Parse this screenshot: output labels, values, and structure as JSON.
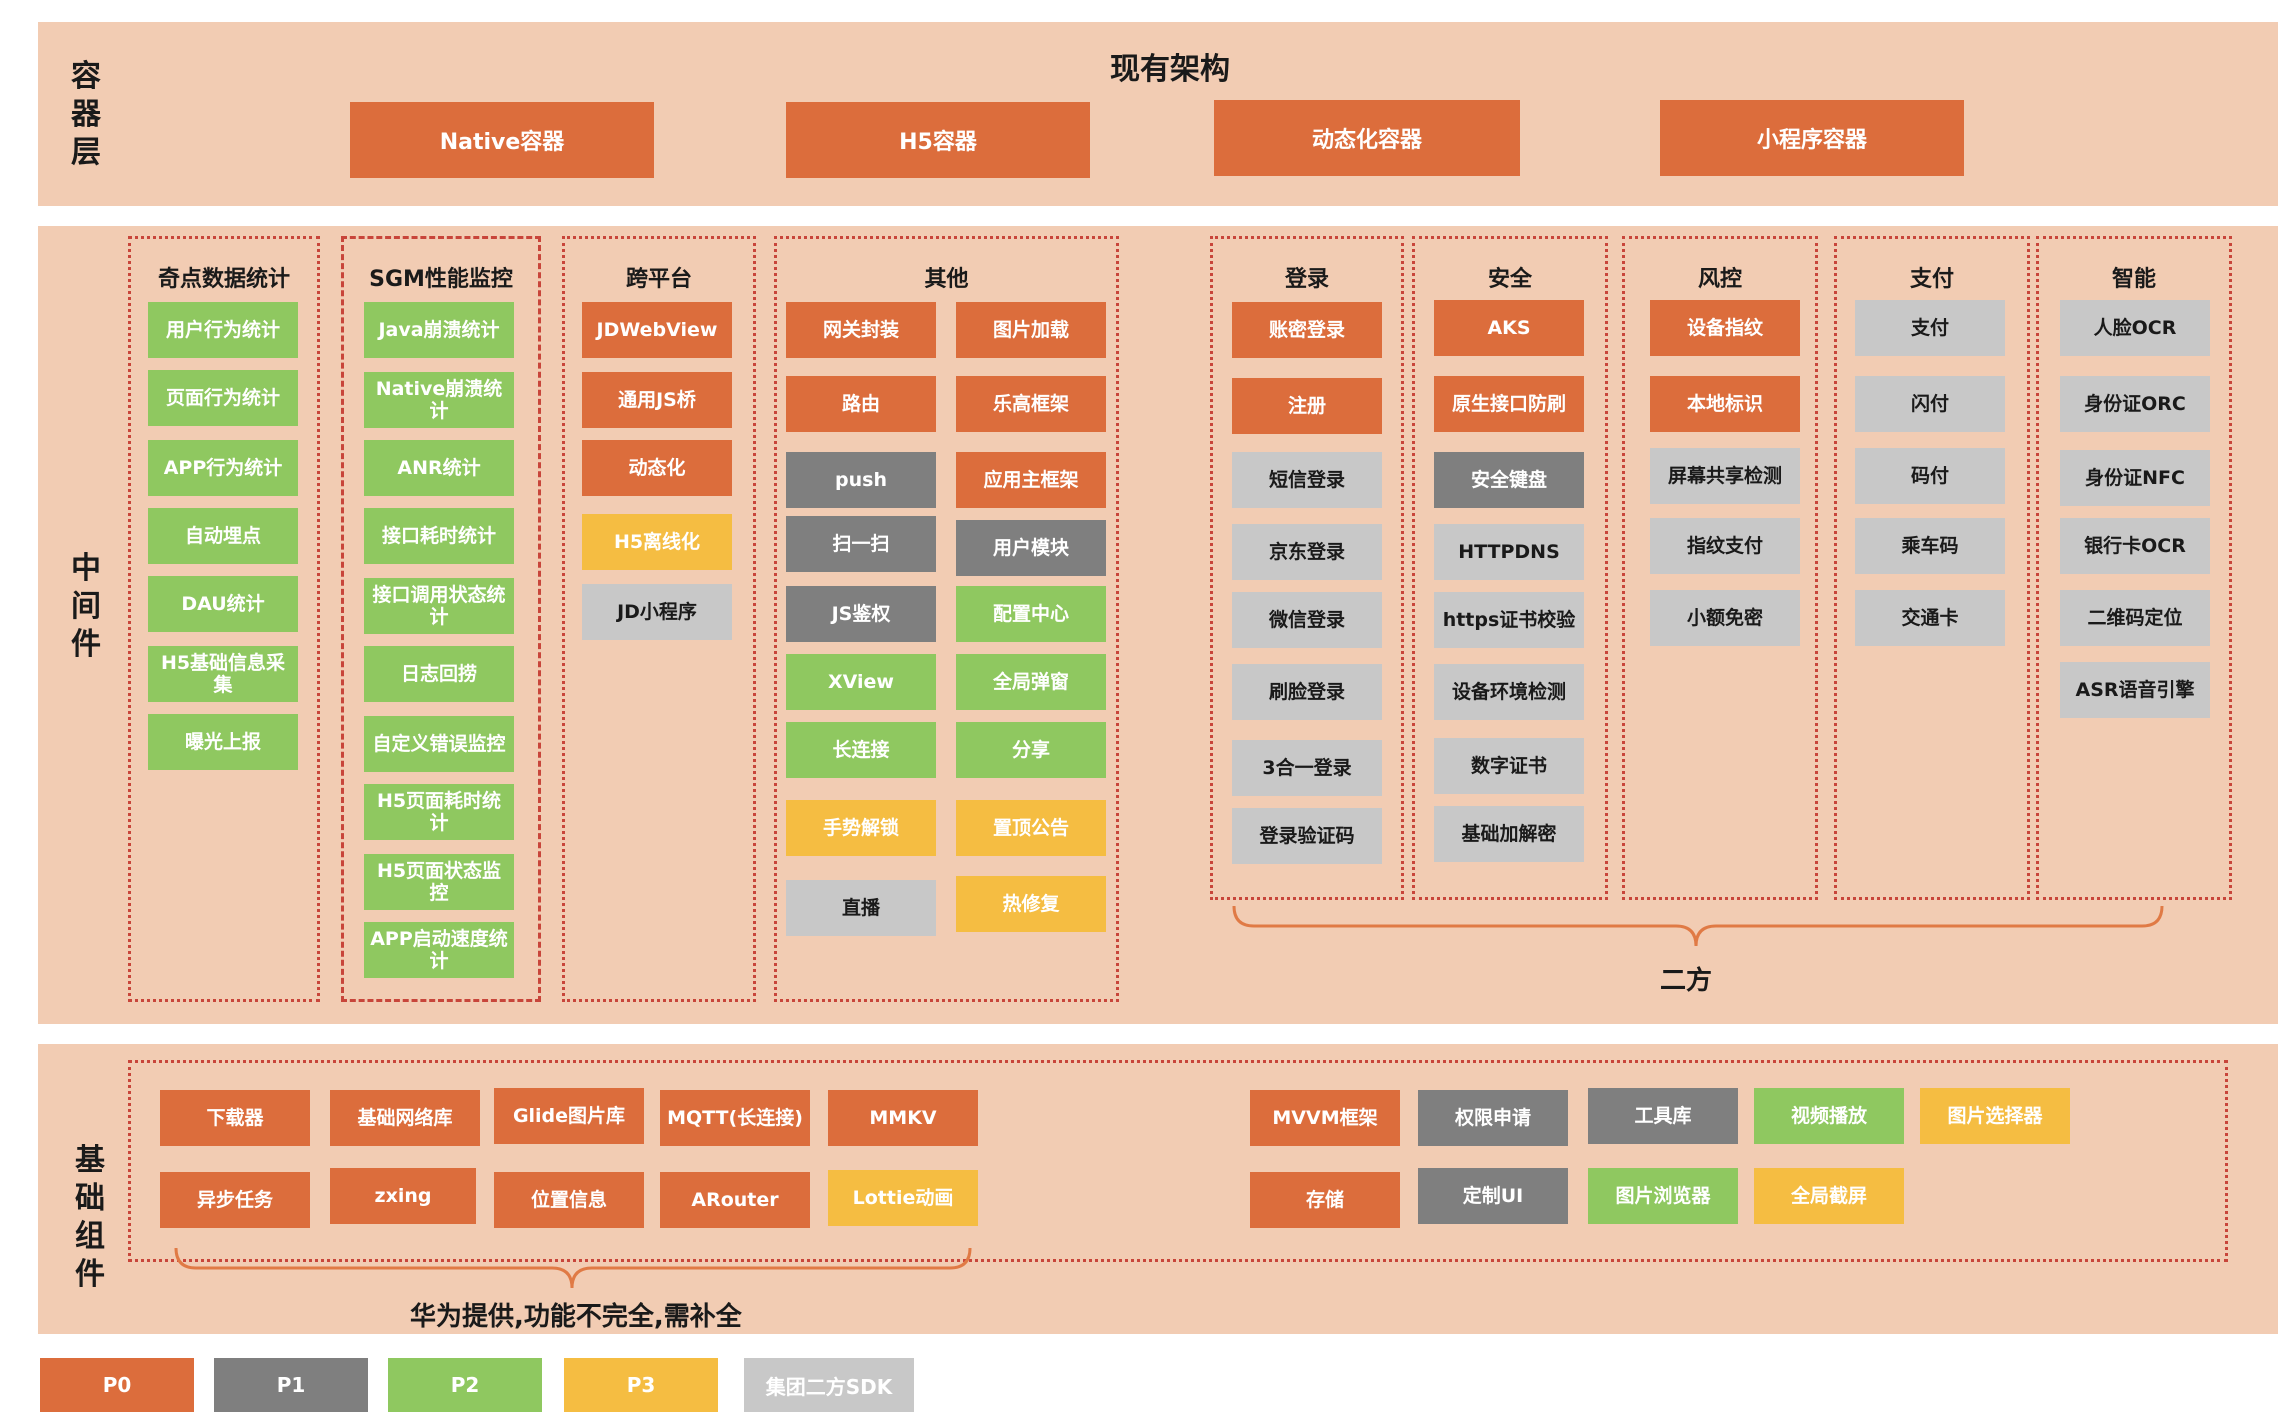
{
  "colors": {
    "p0": "#dc6d3c",
    "p1": "#7f7f7f",
    "p2": "#8fc860",
    "p3": "#f5bd42",
    "sdk": "#c8c8c8",
    "band": "#f2ccb3",
    "border": "#c8453a"
  },
  "container": {
    "side_label": "容\n器\n层",
    "title": "现有架构",
    "items": [
      "Native容器",
      "H5容器",
      "动态化容器",
      "小程序容器"
    ]
  },
  "middleware": {
    "side_label": "中\n间\n件",
    "columns": [
      {
        "title": "奇点数据统计",
        "items": [
          {
            "label": "用户行为统计",
            "level": "p2"
          },
          {
            "label": "页面行为统计",
            "level": "p2"
          },
          {
            "label": "APP行为统计",
            "level": "p2"
          },
          {
            "label": "自动埋点",
            "level": "p2"
          },
          {
            "label": "DAU统计",
            "level": "p2"
          },
          {
            "label": "H5基础信息采集",
            "level": "p2"
          },
          {
            "label": "曝光上报",
            "level": "p2"
          }
        ]
      },
      {
        "title": "SGM性能监控",
        "items": [
          {
            "label": "Java崩溃统计",
            "level": "p2"
          },
          {
            "label": "Native崩溃统计",
            "level": "p2"
          },
          {
            "label": "ANR统计",
            "level": "p2"
          },
          {
            "label": "接口耗时统计",
            "level": "p2"
          },
          {
            "label": "接口调用状态统计",
            "level": "p2"
          },
          {
            "label": "日志回捞",
            "level": "p2"
          },
          {
            "label": "自定义错误监控",
            "level": "p2"
          },
          {
            "label": "H5页面耗时统计",
            "level": "p2"
          },
          {
            "label": "H5页面状态监控",
            "level": "p2"
          },
          {
            "label": "APP启动速度统计",
            "level": "p2"
          }
        ]
      },
      {
        "title": "跨平台",
        "items": [
          {
            "label": "JDWebView",
            "level": "p0"
          },
          {
            "label": "通用JS桥",
            "level": "p0"
          },
          {
            "label": "动态化",
            "level": "p0"
          },
          {
            "label": "H5离线化",
            "level": "p3"
          },
          {
            "label": "JD小程序",
            "level": "sdk"
          }
        ]
      },
      {
        "title": "其他",
        "items": [
          {
            "label": "网关封装",
            "level": "p0"
          },
          {
            "label": "图片加载",
            "level": "p0"
          },
          {
            "label": "路由",
            "level": "p0"
          },
          {
            "label": "乐高框架",
            "level": "p0"
          },
          {
            "label": "push",
            "level": "p1"
          },
          {
            "label": "应用主框架",
            "level": "p0"
          },
          {
            "label": "扫一扫",
            "level": "p1"
          },
          {
            "label": "用户模块",
            "level": "p1"
          },
          {
            "label": "JS鉴权",
            "level": "p1"
          },
          {
            "label": "配置中心",
            "level": "p2"
          },
          {
            "label": "XView",
            "level": "p2"
          },
          {
            "label": "全局弹窗",
            "level": "p2"
          },
          {
            "label": "长连接",
            "level": "p2"
          },
          {
            "label": "分享",
            "level": "p2"
          },
          {
            "label": "手势解锁",
            "level": "p3"
          },
          {
            "label": "置顶公告",
            "level": "p3"
          },
          {
            "label": "直播",
            "level": "sdk"
          },
          {
            "label": "热修复",
            "level": "p3"
          }
        ]
      },
      {
        "title": "登录",
        "items": [
          {
            "label": "账密登录",
            "level": "p0"
          },
          {
            "label": "注册",
            "level": "p0"
          },
          {
            "label": "短信登录",
            "level": "sdk"
          },
          {
            "label": "京东登录",
            "level": "sdk"
          },
          {
            "label": "微信登录",
            "level": "sdk"
          },
          {
            "label": "刷脸登录",
            "level": "sdk"
          },
          {
            "label": "3合一登录",
            "level": "sdk"
          },
          {
            "label": "登录验证码",
            "level": "sdk"
          }
        ]
      },
      {
        "title": "安全",
        "items": [
          {
            "label": "AKS",
            "level": "p0"
          },
          {
            "label": "原生接口防刷",
            "level": "p0"
          },
          {
            "label": "安全键盘",
            "level": "p1"
          },
          {
            "label": "HTTPDNS",
            "level": "sdk"
          },
          {
            "label": "https证书校验",
            "level": "sdk"
          },
          {
            "label": "设备环境检测",
            "level": "sdk"
          },
          {
            "label": "数字证书",
            "level": "sdk"
          },
          {
            "label": "基础加解密",
            "level": "sdk"
          }
        ]
      },
      {
        "title": "风控",
        "items": [
          {
            "label": "设备指纹",
            "level": "p0"
          },
          {
            "label": "本地标识",
            "level": "p0"
          },
          {
            "label": "屏幕共享检测",
            "level": "sdk"
          },
          {
            "label": "指纹支付",
            "level": "sdk"
          },
          {
            "label": "小额免密",
            "level": "sdk"
          }
        ]
      },
      {
        "title": "支付",
        "items": [
          {
            "label": "支付",
            "level": "sdk"
          },
          {
            "label": "闪付",
            "level": "sdk"
          },
          {
            "label": "码付",
            "level": "sdk"
          },
          {
            "label": "乘车码",
            "level": "sdk"
          },
          {
            "label": "交通卡",
            "level": "sdk"
          }
        ]
      },
      {
        "title": "智能",
        "items": [
          {
            "label": "人脸OCR",
            "level": "sdk"
          },
          {
            "label": "身份证ORC",
            "level": "sdk"
          },
          {
            "label": "身份证NFC",
            "level": "sdk"
          },
          {
            "label": "银行卡OCR",
            "level": "sdk"
          },
          {
            "label": "二维码定位",
            "level": "sdk"
          },
          {
            "label": "ASR语音引擎",
            "level": "sdk"
          }
        ]
      }
    ],
    "brace_label": "二方"
  },
  "base": {
    "side_label": "基\n础\n组\n件",
    "items": [
      {
        "label": "下载器",
        "level": "p0"
      },
      {
        "label": "基础网络库",
        "level": "p0"
      },
      {
        "label": "Glide图片库",
        "level": "p0"
      },
      {
        "label": "MQTT(长连接)",
        "level": "p0"
      },
      {
        "label": "MMKV",
        "level": "p0"
      },
      {
        "label": "异步任务",
        "level": "p0"
      },
      {
        "label": "zxing",
        "level": "p0"
      },
      {
        "label": "位置信息",
        "level": "p0"
      },
      {
        "label": "ARouter",
        "level": "p0"
      },
      {
        "label": "Lottie动画",
        "level": "p3"
      },
      {
        "label": "MVVM框架",
        "level": "p0"
      },
      {
        "label": "权限申请",
        "level": "p1"
      },
      {
        "label": "工具库",
        "level": "p1"
      },
      {
        "label": "视频播放",
        "level": "p2"
      },
      {
        "label": "图片选择器",
        "level": "p3"
      },
      {
        "label": "存储",
        "level": "p0"
      },
      {
        "label": "定制UI",
        "level": "p1"
      },
      {
        "label": "图片浏览器",
        "level": "p2"
      },
      {
        "label": "全局截屏",
        "level": "p3"
      }
    ],
    "brace_label": "华为提供,功能不完全,需补全"
  },
  "legend": [
    {
      "label": "P0",
      "level": "p0"
    },
    {
      "label": "P1",
      "level": "p1"
    },
    {
      "label": "P2",
      "level": "p2"
    },
    {
      "label": "P3",
      "level": "p3"
    },
    {
      "label": "集团二方SDK",
      "level": "sdk"
    }
  ]
}
